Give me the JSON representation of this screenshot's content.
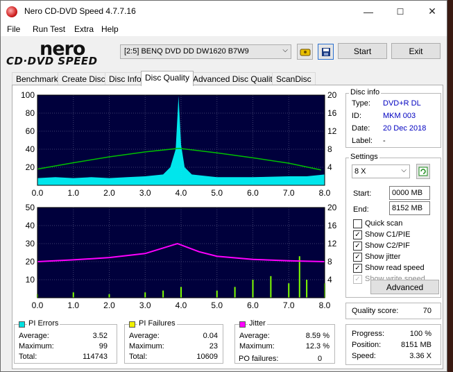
{
  "window": {
    "title": "Nero CD-DVD Speed 4.7.7.16",
    "minimize": "—",
    "maximize": "☐",
    "close": "✕"
  },
  "menu": [
    "File",
    "Run Test",
    "Extra",
    "Help"
  ],
  "logo": {
    "line1": "nero",
    "line2": "CD·DVD SPEED"
  },
  "toolbar": {
    "drive": "[2:5]   BENQ DVD DD DW1620 B7W9",
    "start": "Start",
    "exit": "Exit",
    "icons": [
      "eject-icon",
      "save-icon"
    ]
  },
  "tabs": [
    {
      "label": "Benchmark",
      "active": false
    },
    {
      "label": "Create Disc",
      "active": false
    },
    {
      "label": "Disc Info",
      "active": false
    },
    {
      "label": "Disc Quality",
      "active": true
    },
    {
      "label": "Advanced Disc Quality",
      "active": false
    },
    {
      "label": "ScanDisc",
      "active": false
    }
  ],
  "disc_info": {
    "title": "Disc info",
    "rows": [
      {
        "label": "Type:",
        "value": "DVD+R DL"
      },
      {
        "label": "ID:",
        "value": "MKM 003"
      },
      {
        "label": "Date:",
        "value": "20 Dec 2018"
      },
      {
        "label": "Label:",
        "value": "-"
      }
    ]
  },
  "settings": {
    "title": "Settings",
    "speed": "8 X",
    "start_label": "Start:",
    "start_value": "0000 MB",
    "end_label": "End:",
    "end_value": "8152 MB",
    "checks": [
      {
        "label": "Quick scan",
        "checked": false,
        "disabled": false
      },
      {
        "label": "Show C1/PIE",
        "checked": true,
        "disabled": false
      },
      {
        "label": "Show C2/PIF",
        "checked": true,
        "disabled": false
      },
      {
        "label": "Show jitter",
        "checked": true,
        "disabled": false
      },
      {
        "label": "Show read speed",
        "checked": true,
        "disabled": false
      },
      {
        "label": "Show write speed",
        "checked": true,
        "disabled": true
      }
    ],
    "advanced": "Advanced"
  },
  "quality": {
    "label": "Quality score:",
    "value": "70"
  },
  "progress": {
    "rows": [
      {
        "label": "Progress:",
        "value": "100 %"
      },
      {
        "label": "Position:",
        "value": "8151 MB"
      },
      {
        "label": "Speed:",
        "value": "3.36 X"
      }
    ]
  },
  "stats": {
    "pi_errors": {
      "title": "PI Errors",
      "color": "#00e0e0",
      "rows": [
        [
          "Average:",
          "3.52"
        ],
        [
          "Maximum:",
          "99"
        ],
        [
          "Total:",
          "114743"
        ]
      ]
    },
    "pi_failures": {
      "title": "PI Failures",
      "color": "#f0f000",
      "rows": [
        [
          "Average:",
          "0.04"
        ],
        [
          "Maximum:",
          "23"
        ],
        [
          "Total:",
          "10609"
        ]
      ]
    },
    "jitter": {
      "title": "Jitter",
      "color": "#ff00ff",
      "rows": [
        [
          "Average:",
          "8.59 %"
        ],
        [
          "Maximum:",
          "12.3 %"
        ]
      ],
      "po_label": "PO failures:",
      "po_value": "0"
    }
  },
  "chart_data": [
    {
      "type": "area",
      "name": "PI Errors / Read speed",
      "x_ticks": [
        "0.0",
        "1.0",
        "2.0",
        "3.0",
        "4.0",
        "5.0",
        "6.0",
        "7.0",
        "8.0"
      ],
      "y_left_ticks": [
        "100",
        "80",
        "60",
        "40",
        "20"
      ],
      "y_right_ticks": [
        "20",
        "16",
        "12",
        "8",
        "4"
      ],
      "xlim": [
        0,
        8
      ],
      "ylim_left": [
        0,
        100
      ],
      "ylim_right": [
        0,
        20
      ],
      "series": [
        {
          "kind": "pi_errors",
          "color": "#00ffff",
          "points": [
            [
              0,
              8
            ],
            [
              0.5,
              9
            ],
            [
              1,
              8
            ],
            [
              1.5,
              9
            ],
            [
              2,
              8
            ],
            [
              2.5,
              9
            ],
            [
              3,
              10
            ],
            [
              3.5,
              12
            ],
            [
              3.7,
              20
            ],
            [
              3.85,
              40
            ],
            [
              3.93,
              99
            ],
            [
              4.0,
              45
            ],
            [
              4.1,
              20
            ],
            [
              4.3,
              12
            ],
            [
              5,
              9
            ],
            [
              6,
              9
            ],
            [
              7,
              10
            ],
            [
              7.5,
              10
            ],
            [
              8,
              12
            ]
          ]
        },
        {
          "kind": "read_speed",
          "color": "#00c000",
          "points": [
            [
              0,
              3.6
            ],
            [
              1,
              5.0
            ],
            [
              2,
              6.3
            ],
            [
              3,
              7.4
            ],
            [
              3.95,
              8.2
            ],
            [
              5,
              7.2
            ],
            [
              6,
              6.1
            ],
            [
              7,
              4.9
            ],
            [
              7.9,
              3.4
            ]
          ]
        }
      ]
    },
    {
      "type": "area",
      "name": "PI Failures / Jitter",
      "x_ticks": [
        "0.0",
        "1.0",
        "2.0",
        "3.0",
        "4.0",
        "5.0",
        "6.0",
        "7.0",
        "8.0"
      ],
      "y_left_ticks": [
        "50",
        "40",
        "30",
        "20",
        "10"
      ],
      "y_right_ticks": [
        "20",
        "16",
        "12",
        "8",
        "4"
      ],
      "xlim": [
        0,
        8
      ],
      "ylim_left": [
        0,
        50
      ],
      "ylim_right": [
        0,
        20
      ],
      "series": [
        {
          "kind": "pi_failures",
          "color": "#80ff00",
          "points": [
            [
              0,
              2
            ],
            [
              1,
              3
            ],
            [
              2,
              2
            ],
            [
              3,
              3
            ],
            [
              3.5,
              4
            ],
            [
              4,
              6
            ],
            [
              5,
              4
            ],
            [
              5.5,
              6
            ],
            [
              6,
              10
            ],
            [
              6.5,
              12
            ],
            [
              7,
              8
            ],
            [
              7.3,
              23
            ],
            [
              7.5,
              10
            ],
            [
              8,
              8
            ]
          ]
        },
        {
          "kind": "jitter",
          "color": "#ff00ff",
          "points": [
            [
              0,
              8.0
            ],
            [
              1,
              8.4
            ],
            [
              2,
              8.9
            ],
            [
              3,
              9.8
            ],
            [
              3.9,
              12.0
            ],
            [
              4.5,
              10.2
            ],
            [
              5,
              9.2
            ],
            [
              6,
              8.5
            ],
            [
              7,
              8.2
            ],
            [
              8,
              8.0
            ]
          ]
        }
      ]
    }
  ]
}
